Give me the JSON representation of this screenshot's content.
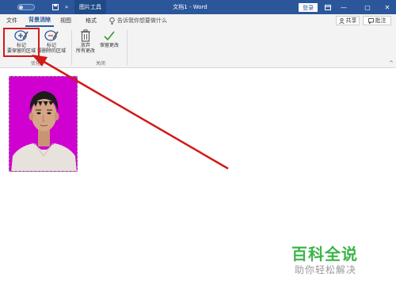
{
  "titlebar": {
    "contextual_tab": "图片工具",
    "document_title": "文档1 - Word",
    "login_button": "登录",
    "minimize": "—",
    "restore": "▢",
    "close": "✕",
    "colors": {
      "bar": "#2b579a"
    }
  },
  "tabs": {
    "items": [
      {
        "label": "文件"
      },
      {
        "label": "背景消除"
      },
      {
        "label": "视图"
      },
      {
        "label": "格式"
      }
    ],
    "active_index": 1,
    "tell_me": "告诉我你想要做什么",
    "share": "共享",
    "comment": "批注"
  },
  "ribbon": {
    "mark_keep_line1": "标记",
    "mark_keep_line2": "要保留的区域",
    "mark_remove_line1": "标记",
    "mark_remove_line2": "要删除的区域",
    "discard_line1": "放弃",
    "discard_line2": "所有更改",
    "keep_changes": "保留更改",
    "group_optimize": "优化",
    "group_close": "关闭"
  },
  "document": {
    "photo_background": "#d000d0",
    "annotation_color": "#d11a1a"
  },
  "watermark": {
    "title": "百科全说",
    "subtitle": "助你轻松解决"
  }
}
